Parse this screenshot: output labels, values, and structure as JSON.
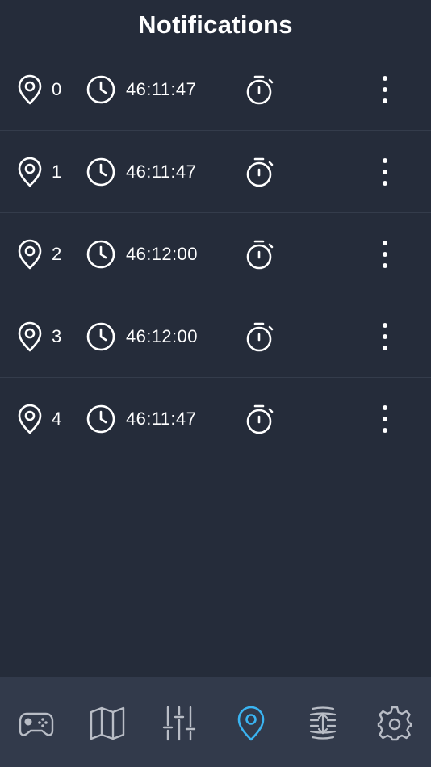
{
  "header": {
    "title": "Notifications"
  },
  "notifications": [
    {
      "index": "0",
      "time": "46:11:47"
    },
    {
      "index": "1",
      "time": "46:11:47"
    },
    {
      "index": "2",
      "time": "46:12:00"
    },
    {
      "index": "3",
      "time": "46:12:00"
    },
    {
      "index": "4",
      "time": "46:11:47"
    }
  ],
  "tabbar": {
    "tabs": [
      {
        "icon": "gamepad-icon",
        "active": false
      },
      {
        "icon": "map-icon",
        "active": false
      },
      {
        "icon": "sliders-icon",
        "active": false
      },
      {
        "icon": "location-pin-icon",
        "active": true
      },
      {
        "icon": "altitude-icon",
        "active": false
      },
      {
        "icon": "gear-icon",
        "active": false
      }
    ]
  },
  "colors": {
    "background": "#252c3a",
    "tabbar_background": "#323a4b",
    "active_tab": "#3ab4f2",
    "inactive_tab": "#b9bdc6",
    "text": "#ffffff"
  }
}
